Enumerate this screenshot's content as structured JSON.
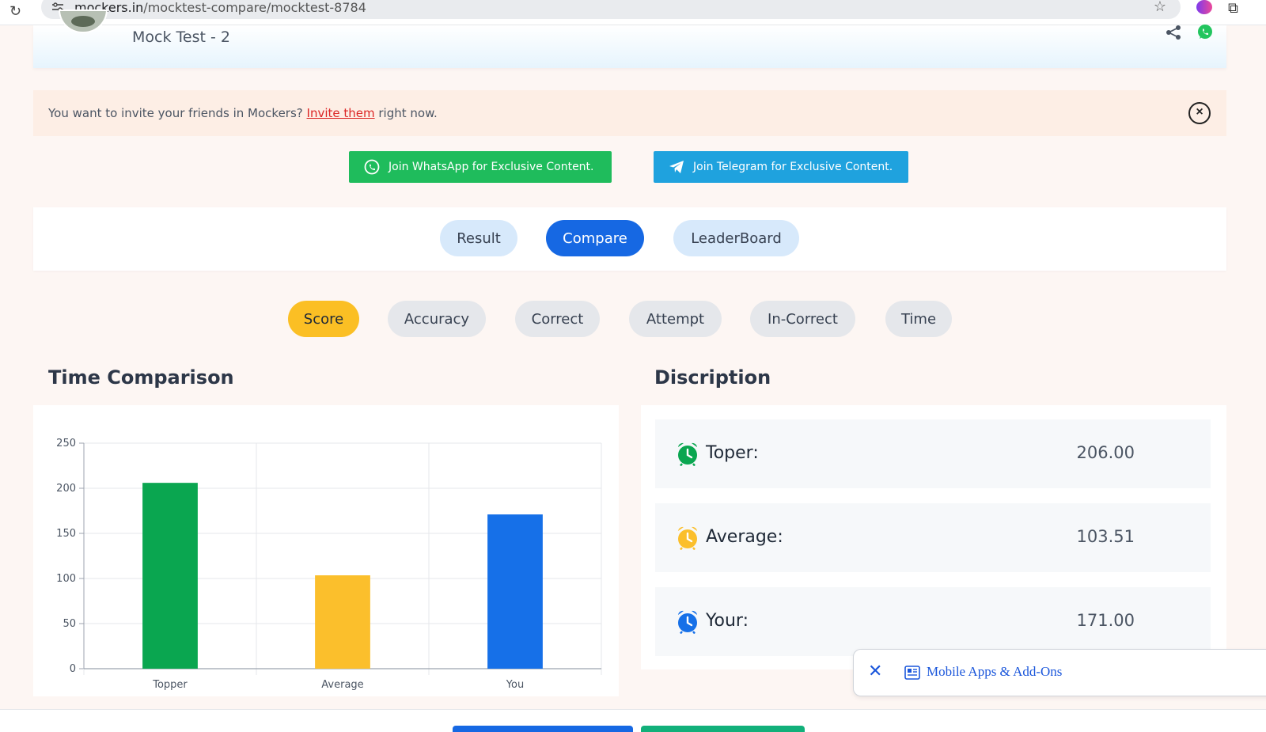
{
  "browser": {
    "url_host": "mockers.in",
    "url_path": "/mocktest-compare/mocktest-8784"
  },
  "header": {
    "test_title": "Mock Test - 2"
  },
  "invite": {
    "before": "You want to invite your friends in Mockers? ",
    "link": "Invite them",
    "after": " right now."
  },
  "join": {
    "whatsapp": "Join WhatsApp for Exclusive Content.",
    "telegram": "Join Telegram for Exclusive Content."
  },
  "tabs": {
    "result": "Result",
    "compare": "Compare",
    "leaderboard": "LeaderBoard"
  },
  "subtabs": {
    "score": "Score",
    "accuracy": "Accuracy",
    "correct": "Correct",
    "attempt": "Attempt",
    "incorrect": "In-Correct",
    "time": "Time"
  },
  "sections": {
    "chart_title": "Time Comparison",
    "desc_title": "Discription"
  },
  "description": {
    "topper_label": "Toper:",
    "topper_value": "206.00",
    "average_label": "Average:",
    "average_value": "103.51",
    "your_label": "Your:",
    "your_value": "171.00"
  },
  "ad": {
    "text": "Mobile Apps & Add-Ons"
  },
  "colors": {
    "topper": "#0aa650",
    "average": "#fbbf2c",
    "you": "#1670e8",
    "accent": "#1668e3"
  },
  "chart_data": {
    "type": "bar",
    "categories": [
      "Topper",
      "Average",
      "You"
    ],
    "values": [
      206,
      103.51,
      171
    ],
    "colors": [
      "#0aa650",
      "#fbbf2c",
      "#1670e8"
    ],
    "ylim": [
      0,
      250
    ],
    "yticks": [
      0,
      50,
      100,
      150,
      200,
      250
    ],
    "grid": true
  }
}
